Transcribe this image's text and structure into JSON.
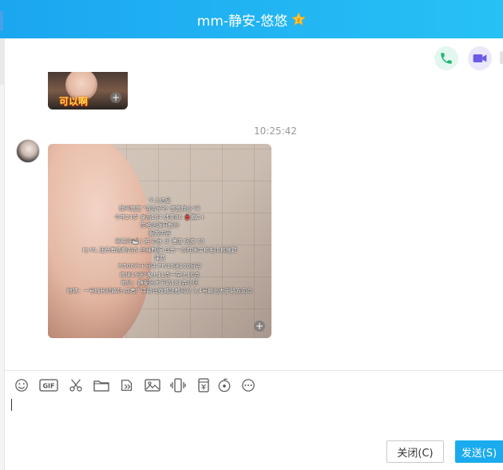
{
  "window": {
    "title": "mm-静安-悠悠",
    "accent_color": "#1ba6f0",
    "badge_icon": "star-badge-icon"
  },
  "header_actions": {
    "voice_call_icon": "phone-icon",
    "video_call_icon": "video-camera-icon"
  },
  "messages": [
    {
      "type": "image",
      "caption": "可以啊"
    },
    {
      "type": "timestamp",
      "time": "10:25:42"
    },
    {
      "type": "image",
      "image_text": [
        "个人信息",
        "我叫悠悠 \"青青子衿 悠悠我心\"😀",
        "今年24岁 身高164 体重86 👙胸C+",
        "性格活泼开朗😊",
        "服务内容",
        "鸳鸯浴🛀 | 推 过水 dl 漫游 吸皮 69",
        "KJ ML 还备有情趣内衣 丝袜制服 具备一次性床单和毛巾和拖鞋",
        "课费",
        "P/500六十分钟 PP/10张100分钟",
        "夜读19张\"晚上11点一早上10点",
        "地址：静安区大宁路181弄小区",
        "地铁：一号线长延路站 或者广中路马戏城站都可以 3,4号口出大宁路方向😊"
      ]
    }
  ],
  "toolbar": {
    "icons": [
      "smiley-icon",
      "gif-icon",
      "scissors-icon",
      "folder-icon",
      "file-transfer-icon",
      "image-icon",
      "shake-icon",
      "red-packet-icon",
      "music-icon",
      "more-icon"
    ],
    "gif_label": "GIF"
  },
  "buttons": {
    "close": "关闭(C)",
    "send": "发送(S)"
  }
}
